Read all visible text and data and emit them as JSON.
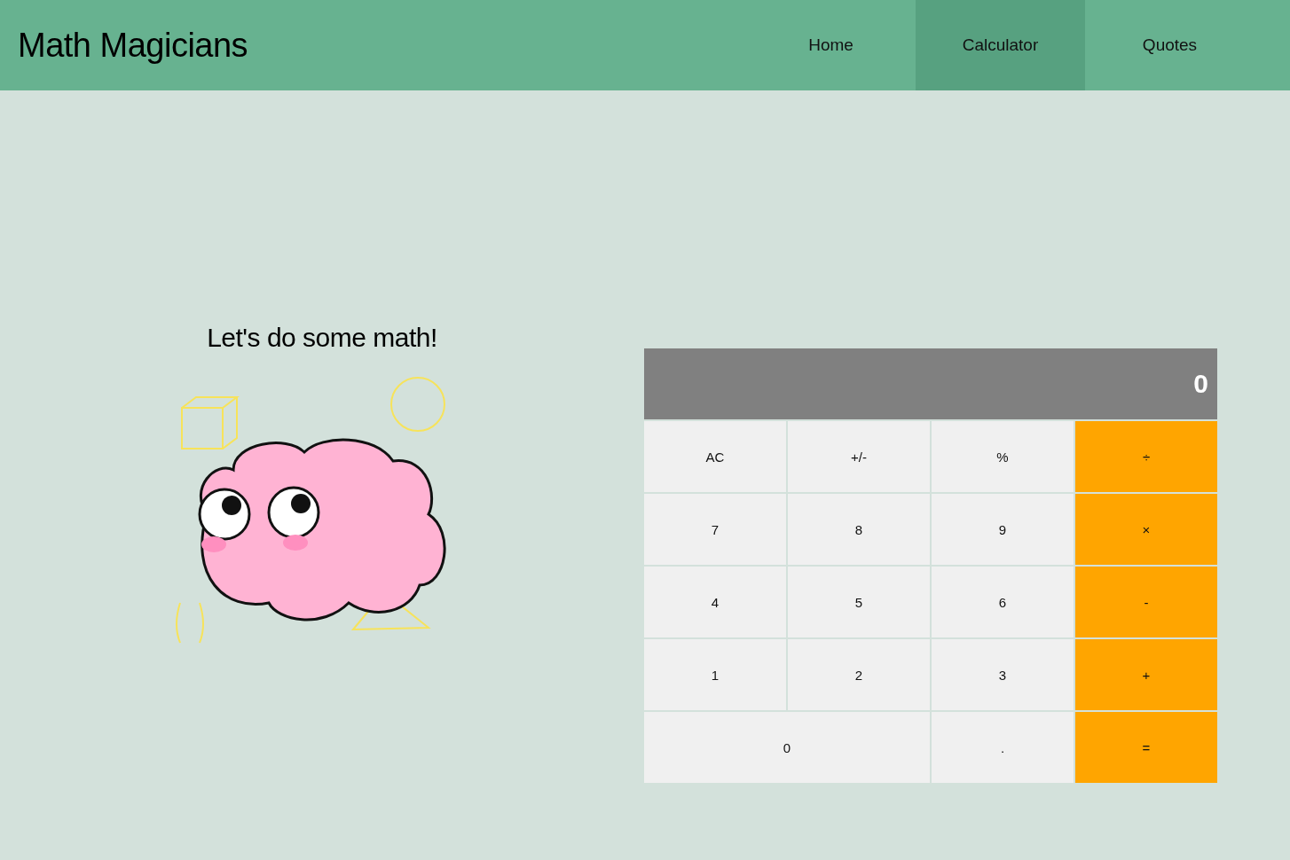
{
  "header": {
    "title": "Math Magicians",
    "nav": [
      {
        "label": "Home",
        "selected": false
      },
      {
        "label": "Calculator",
        "selected": true
      },
      {
        "label": "Quotes",
        "selected": false
      }
    ]
  },
  "intro": {
    "heading": "Let's do some math!"
  },
  "calculator": {
    "display": "0",
    "keys": [
      {
        "label": "AC",
        "kind": "function",
        "wide": false
      },
      {
        "label": "+/-",
        "kind": "function",
        "wide": false
      },
      {
        "label": "%",
        "kind": "function",
        "wide": false
      },
      {
        "label": "÷",
        "kind": "operator",
        "wide": false
      },
      {
        "label": "7",
        "kind": "digit",
        "wide": false
      },
      {
        "label": "8",
        "kind": "digit",
        "wide": false
      },
      {
        "label": "9",
        "kind": "digit",
        "wide": false
      },
      {
        "label": "×",
        "kind": "operator",
        "wide": false
      },
      {
        "label": "4",
        "kind": "digit",
        "wide": false
      },
      {
        "label": "5",
        "kind": "digit",
        "wide": false
      },
      {
        "label": "6",
        "kind": "digit",
        "wide": false
      },
      {
        "label": "-",
        "kind": "operator",
        "wide": false
      },
      {
        "label": "1",
        "kind": "digit",
        "wide": false
      },
      {
        "label": "2",
        "kind": "digit",
        "wide": false
      },
      {
        "label": "3",
        "kind": "digit",
        "wide": false
      },
      {
        "label": "+",
        "kind": "operator",
        "wide": false
      },
      {
        "label": "0",
        "kind": "digit",
        "wide": true
      },
      {
        "label": ".",
        "kind": "digit",
        "wide": false
      },
      {
        "label": "=",
        "kind": "operator",
        "wide": false
      }
    ]
  }
}
